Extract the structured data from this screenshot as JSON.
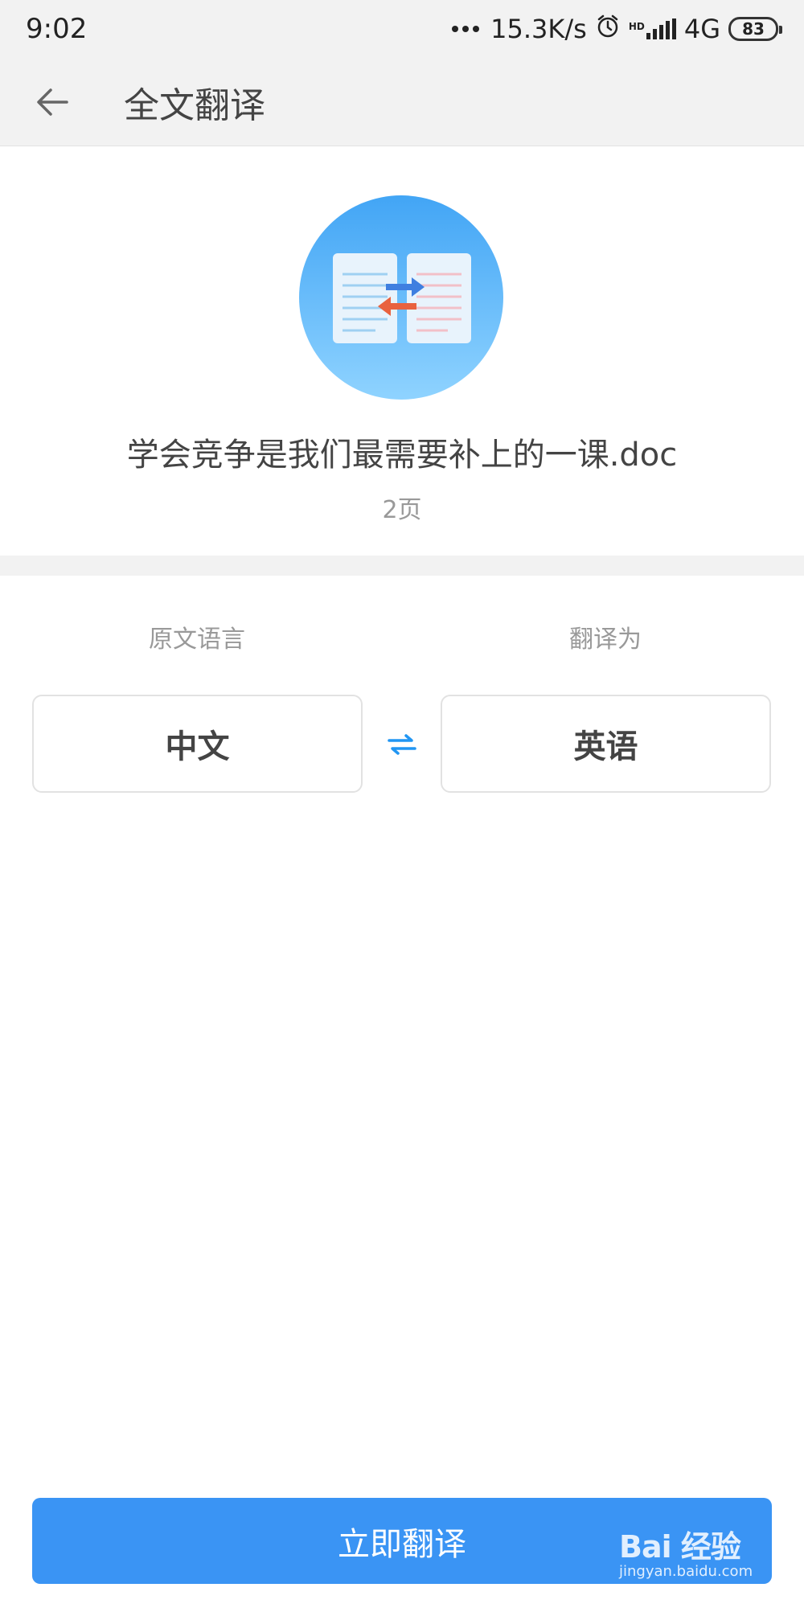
{
  "status_bar": {
    "time": "9:02",
    "net_speed": "15.3K/s",
    "network": "4G",
    "hd_label": "HD",
    "battery": "83"
  },
  "header": {
    "title": "全文翻译"
  },
  "file": {
    "name": "学会竞争是我们最需要补上的一课.doc",
    "pages": "2页"
  },
  "language": {
    "source_label": "原文语言",
    "target_label": "翻译为",
    "source_value": "中文",
    "target_value": "英语"
  },
  "action": {
    "translate_label": "立即翻译"
  },
  "watermark": {
    "main": "Bai 经验",
    "sub": "jingyan.baidu.com"
  },
  "colors": {
    "primary": "#3a94f4",
    "icon_gradient_top": "#42a5f5",
    "icon_gradient_bottom": "#8fd3ff",
    "swap_icon": "#2196f3"
  }
}
